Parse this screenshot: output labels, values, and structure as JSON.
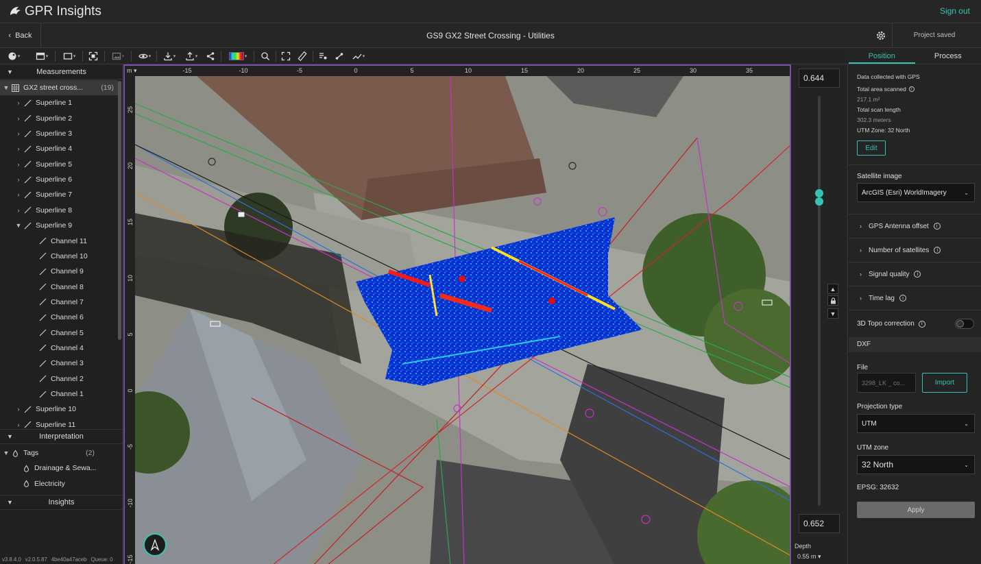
{
  "app": {
    "title": "GPR Insights",
    "signout": "Sign out"
  },
  "subbar": {
    "back": "Back",
    "title": "GS9 GX2 Street Crossing - Utilities",
    "status": "Project saved"
  },
  "left": {
    "measurements_header": "Measurements",
    "dataset": {
      "label": "GX2 street cross...",
      "count": "(19)"
    },
    "superlines_a": [
      "Superline 1",
      "Superline 2",
      "Superline 3",
      "Superline 4",
      "Superline 5",
      "Superline 6",
      "Superline 7",
      "Superline 8",
      "Superline 9"
    ],
    "channels": [
      "Channel 11",
      "Channel 10",
      "Channel 9",
      "Channel 8",
      "Channel 7",
      "Channel 6",
      "Channel 5",
      "Channel 4",
      "Channel 3",
      "Channel 2",
      "Channel 1"
    ],
    "superlines_b": [
      "Superline 10",
      "Superline 11"
    ],
    "interpretation_header": "Interpretation",
    "tags": {
      "label": "Tags",
      "count": "(2)",
      "items": [
        "Drainage & Sewa...",
        "Electricity"
      ]
    },
    "insights_header": "Insights",
    "version": [
      "v3.8.4.0",
      "v2.0.5.87",
      "4be40a47aceb",
      "Queue: 0"
    ]
  },
  "map": {
    "unit": "m",
    "x_ticks": [
      "-15",
      "-10",
      "-5",
      "0",
      "5",
      "10",
      "15",
      "20",
      "25",
      "30",
      "35"
    ],
    "y_ticks": [
      "25",
      "20",
      "15",
      "10",
      "5",
      "0",
      "-5",
      "-10",
      "-15"
    ]
  },
  "depth": {
    "top_value": "0.644",
    "bottom_value": "0.652",
    "label": "Depth",
    "value": "0.55 m"
  },
  "right": {
    "tabs": [
      "Position",
      "Process"
    ],
    "collected": "Data collected with GPS",
    "area_label": "Total area scanned",
    "area_value": "217.1 m²",
    "length_label": "Total scan length",
    "length_value": "302.3 meters",
    "utm": "UTM Zone: 32 North",
    "edit": "Edit",
    "satellite_label": "Satellite image",
    "satellite_value": "ArcGIS (Esri) WorldImagery",
    "accordions": [
      "GPS Antenna offset",
      "Number of satellites",
      "Signal quality",
      "Time lag"
    ],
    "topo": "3D Topo correction",
    "dxf": "DXF",
    "file_label": "File",
    "file_value": "3298_LK _ co...",
    "import": "Import",
    "projection_label": "Projection type",
    "projection_value": "UTM",
    "zone_label": "UTM zone",
    "zone_value": "32 North",
    "epsg": "EPSG: 32632",
    "apply": "Apply"
  },
  "colors": {
    "accent": "#35c3b5",
    "map_border": "#7a4fa8"
  }
}
